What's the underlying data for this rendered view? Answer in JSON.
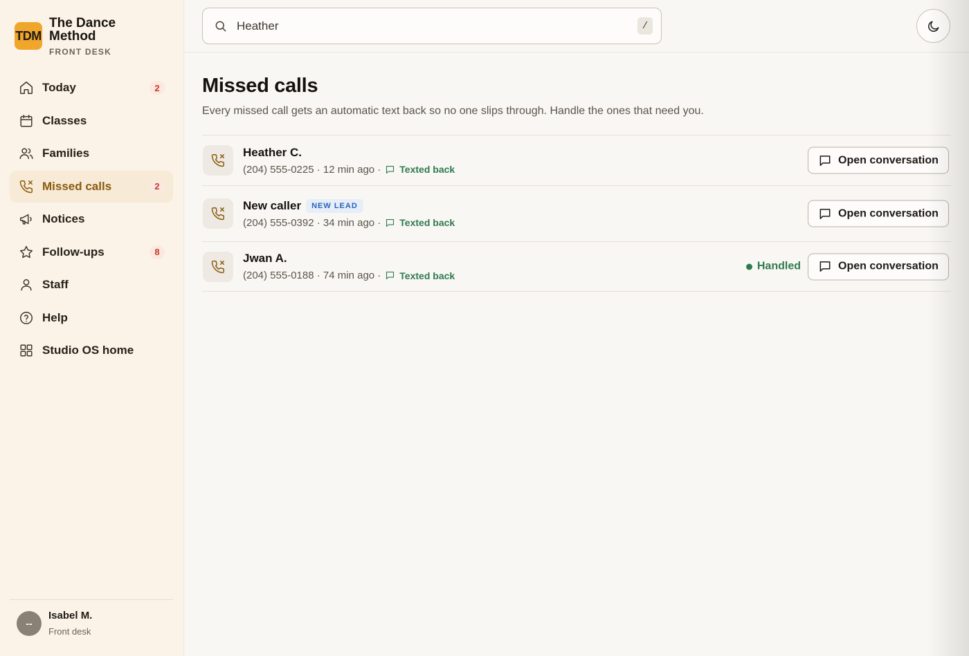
{
  "brand": {
    "logo": "TDM",
    "name": "The Dance Method",
    "subtitle": "FRONT DESK",
    "logo_color": "#f0a62b"
  },
  "sidebar": {
    "items": [
      {
        "label": "Today",
        "icon": "home-icon",
        "badge": "2"
      },
      {
        "label": "Classes",
        "icon": "calendar-icon"
      },
      {
        "label": "Families",
        "icon": "users-icon"
      },
      {
        "label": "Missed calls",
        "icon": "phone-missed-icon",
        "badge": "2",
        "active": true
      },
      {
        "label": "Notices",
        "icon": "megaphone-icon"
      },
      {
        "label": "Follow-ups",
        "icon": "star-icon",
        "badge": "8"
      },
      {
        "label": "Staff",
        "icon": "user-icon"
      },
      {
        "label": "Help",
        "icon": "help-circle-icon"
      },
      {
        "label": "Studio OS home",
        "icon": "grid-icon"
      }
    ]
  },
  "user": {
    "initials": "--",
    "name": "Isabel M.",
    "role": "Front desk"
  },
  "search": {
    "value": "Heather",
    "shortcut": "/"
  },
  "page": {
    "title": "Missed calls",
    "subtitle": "Every missed call gets an automatic text back so no one slips through. Handle the ones that need you."
  },
  "calls": [
    {
      "name": "Heather C.",
      "meta": "(204) 555-0225 · 12 min ago ·",
      "texted": "Texted back",
      "action": "Open conversation"
    },
    {
      "name": "New caller",
      "badge": "NEW LEAD",
      "meta": "(204) 555-0392 · 34 min ago ·",
      "texted": "Texted back",
      "action": "Open conversation"
    },
    {
      "name": "Jwan A.",
      "meta": "(204) 555-0188 · 74 min ago ·",
      "texted": "Texted back",
      "status": "Handled",
      "action": "Open conversation"
    }
  ],
  "colors": {
    "accent": "#8a5a0f",
    "success": "#2f7a4f",
    "badge_red": "#c63b2a",
    "lead_blue": "#2b63b6"
  }
}
